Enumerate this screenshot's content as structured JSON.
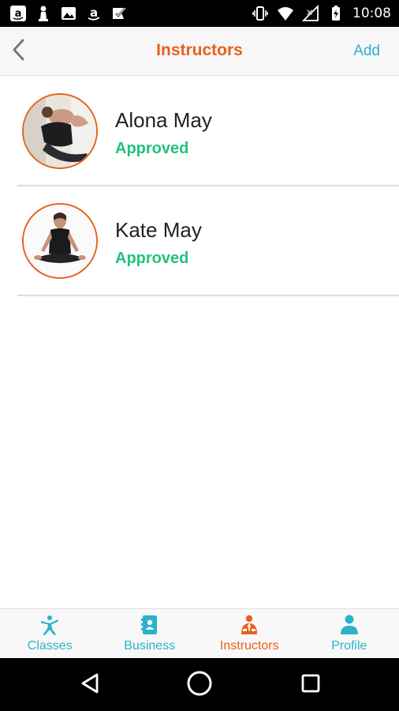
{
  "status_bar": {
    "time": "10:08",
    "left_icons": [
      "amazon-icon",
      "chess-pawn-icon",
      "image-icon",
      "amazon-icon",
      "check-badge-icon"
    ],
    "right_icons": [
      "vibrate-icon",
      "wifi-icon",
      "signal-icon",
      "battery-charging-icon"
    ]
  },
  "app_bar": {
    "title": "Instructors",
    "add_label": "Add",
    "back_icon": "chevron-left-icon"
  },
  "instructors": [
    {
      "name": "Alona May",
      "status": "Approved"
    },
    {
      "name": "Kate May",
      "status": "Approved"
    }
  ],
  "tabs": [
    {
      "label": "Classes",
      "icon": "person-stretch-icon",
      "active": false
    },
    {
      "label": "Business",
      "icon": "contact-book-icon",
      "active": false
    },
    {
      "label": "Instructors",
      "icon": "instructor-icon",
      "active": true
    },
    {
      "label": "Profile",
      "icon": "person-icon",
      "active": false
    }
  ],
  "colors": {
    "accent_orange": "#e8601c",
    "teal": "#2ab3c9",
    "approved_green": "#23c27e"
  }
}
